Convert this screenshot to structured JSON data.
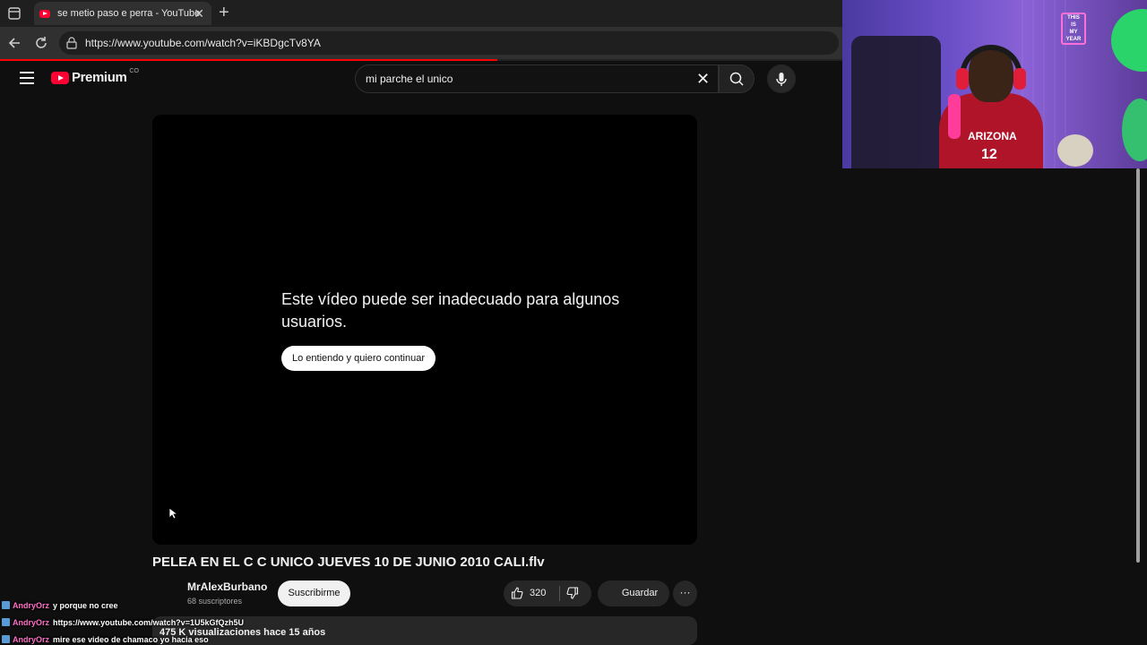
{
  "browser": {
    "tab_title": "se metio paso e perra - YouTube",
    "tab_close": "✕",
    "new_tab": "+",
    "url": "https://www.youtube.com/watch?v=iKBDgcTv8YA",
    "load_progress": 0.59
  },
  "header": {
    "logo_text": "Premium",
    "logo_region": "CO",
    "search_value": "mi parche el unico",
    "clear_symbol": "✕"
  },
  "player": {
    "warning_text": "Este vídeo puede ser inadecuado para algunos usuarios.",
    "continue_label": "Lo entiendo y quiero continuar"
  },
  "video": {
    "title": "PELEA EN EL C C UNICO JUEVES 10 DE JUNIO 2010 CALI.flv",
    "channel": "MrAlexBurbano",
    "subscribers": "68 suscriptores",
    "subscribe_label": "Suscribirme",
    "likes": "320",
    "save_label": "Guardar",
    "more_symbol": "···",
    "views": "475 K visualizaciones   hace 15 años"
  },
  "chat": [
    {
      "user": "AndryOrz",
      "message": "y porque no cree"
    },
    {
      "user": "AndryOrz",
      "message": "https://www.youtube.com/watch?v=1U5kGfQzh5U"
    },
    {
      "user": "AndryOrz",
      "message": "mire ese video de chamaco yo hacia eso"
    }
  ],
  "webcam": {
    "sign_lines": [
      "THIS",
      "IS",
      "MY",
      "YEAR"
    ],
    "jersey_text": "ARIZONA",
    "jersey_number": "12"
  },
  "colors": {
    "background": "#0f0f0f",
    "youtube_red": "#ff0033",
    "chat_username": "#ff6fc8"
  }
}
